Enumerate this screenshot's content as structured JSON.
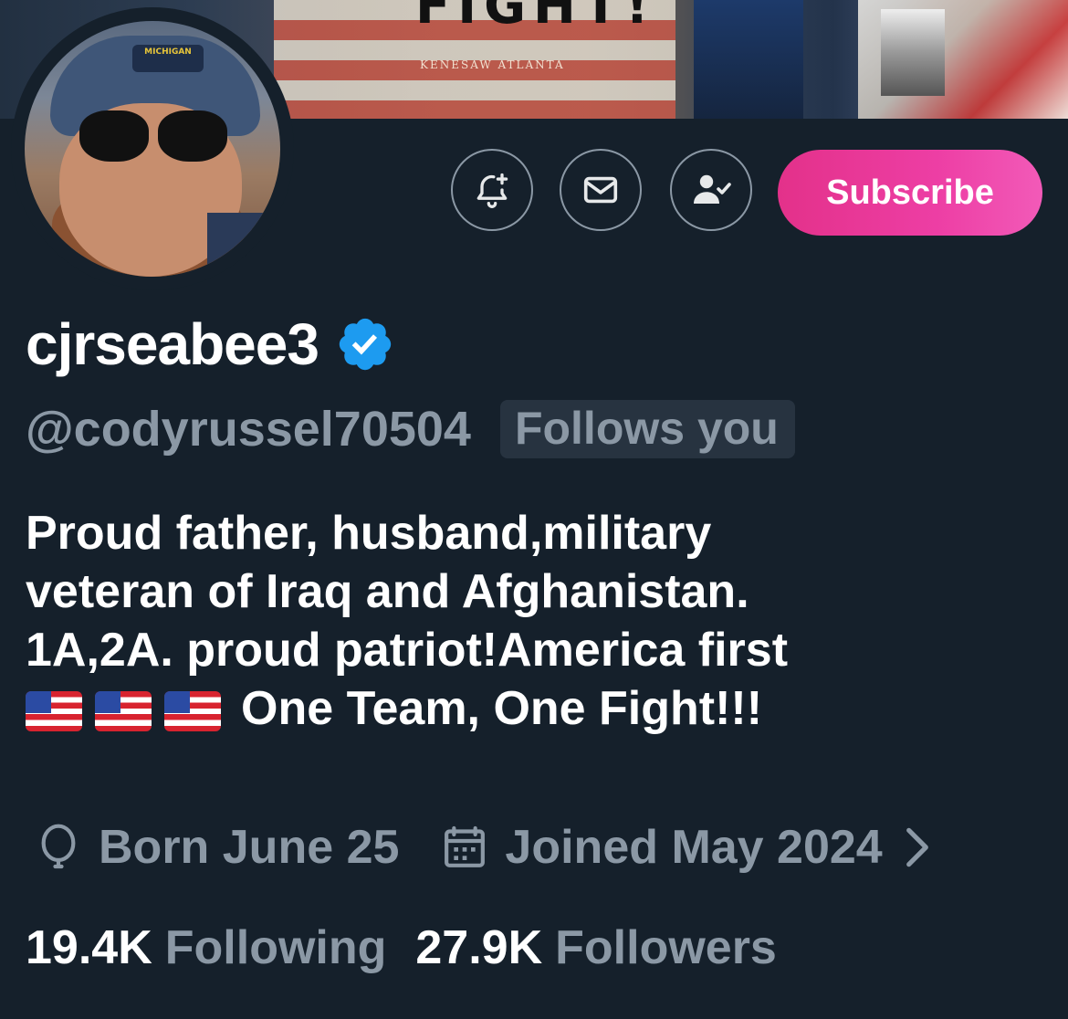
{
  "banner": {
    "fight_text": "FIGHT!",
    "flag_caption": "KENESAW ATLANTA"
  },
  "avatar": {
    "beanie_text": "MICHIGAN"
  },
  "actions": {
    "notify_icon": "bell-plus-icon",
    "message_icon": "mail-icon",
    "following_icon": "person-check-icon",
    "subscribe_label": "Subscribe"
  },
  "profile": {
    "display_name": "cjrseabee3",
    "verified_icon": "verified-badge-icon",
    "handle": "@codyrussel70504",
    "follows_you": "Follows you",
    "bio_lines": [
      "Proud father, husband,military",
      "veteran of Iraq and Afghanistan.",
      "1A,2A. proud patriot!America first",
      "One Team, One Fight!!!"
    ],
    "bio_emoji": [
      "🇺🇸",
      "🇺🇸",
      "🇺🇸"
    ],
    "birthday": "Born June 25",
    "joined": "Joined May 2024",
    "following_count": "19.4K",
    "following_label": "Following",
    "followers_count": "27.9K",
    "followers_label": "Followers"
  },
  "colors": {
    "background": "#15202b",
    "secondary_text": "#8b98a5",
    "verified_blue": "#1d9bf0",
    "subscribe_pink": "#e3318a"
  }
}
